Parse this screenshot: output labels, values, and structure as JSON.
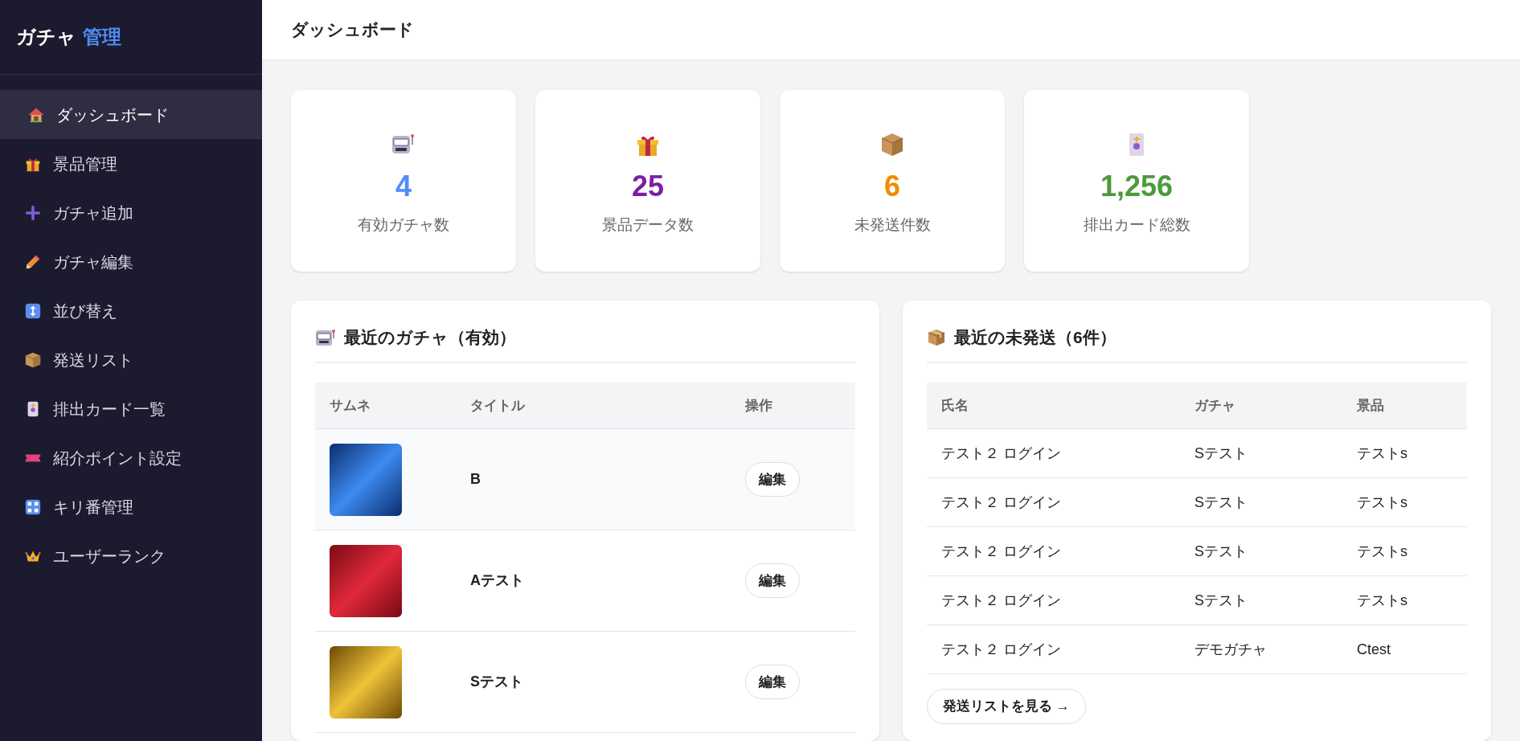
{
  "sidebar": {
    "logo": {
      "word_1": "ガチャ",
      "word_2": "管理"
    },
    "items": [
      {
        "label": "ダッシュボード",
        "selected": true
      },
      {
        "label": "景品管理",
        "selected": false
      },
      {
        "label": "ガチャ追加",
        "selected": false
      },
      {
        "label": "ガチャ編集",
        "selected": false
      },
      {
        "label": "並び替え",
        "selected": false
      },
      {
        "label": "発送リスト",
        "selected": false
      },
      {
        "label": "排出カード一覧",
        "selected": false
      },
      {
        "label": "紹介ポイント設定",
        "selected": false
      },
      {
        "label": "キリ番管理",
        "selected": false
      },
      {
        "label": "ユーザーランク",
        "selected": false
      }
    ]
  },
  "header": {
    "title": "ダッシュボード"
  },
  "stats": [
    {
      "value": "4",
      "label": "有効ガチャ数",
      "color": "#4f8ef7"
    },
    {
      "value": "25",
      "label": "景品データ数",
      "color": "#7b1fa2"
    },
    {
      "value": "6",
      "label": "未発送件数",
      "color": "#f08c00"
    },
    {
      "value": "1,256",
      "label": "排出カード総数",
      "color": "#4c9a3c"
    }
  ],
  "recent_gacha": {
    "title": "最近のガチャ（有効）",
    "columns": [
      "サムネ",
      "タイトル",
      "操作"
    ],
    "rows": [
      {
        "title": "B",
        "action": "編集"
      },
      {
        "title": "Aテスト",
        "action": "編集"
      },
      {
        "title": "Sテスト",
        "action": "編集"
      }
    ]
  },
  "recent_unshipped": {
    "title": "最近の未発送（6件）",
    "columns": [
      "氏名",
      "ガチャ",
      "景品"
    ],
    "rows": [
      [
        "テスト２ ログイン",
        "Sテスト",
        "テストs"
      ],
      [
        "テスト２ ログイン",
        "Sテスト",
        "テストs"
      ],
      [
        "テスト２ ログイン",
        "Sテスト",
        "テストs"
      ],
      [
        "テスト２ ログイン",
        "Sテスト",
        "テストs"
      ],
      [
        "テスト２ ログイン",
        "デモガチャ",
        "Ctest"
      ]
    ],
    "link": "発送リストを見る →"
  }
}
